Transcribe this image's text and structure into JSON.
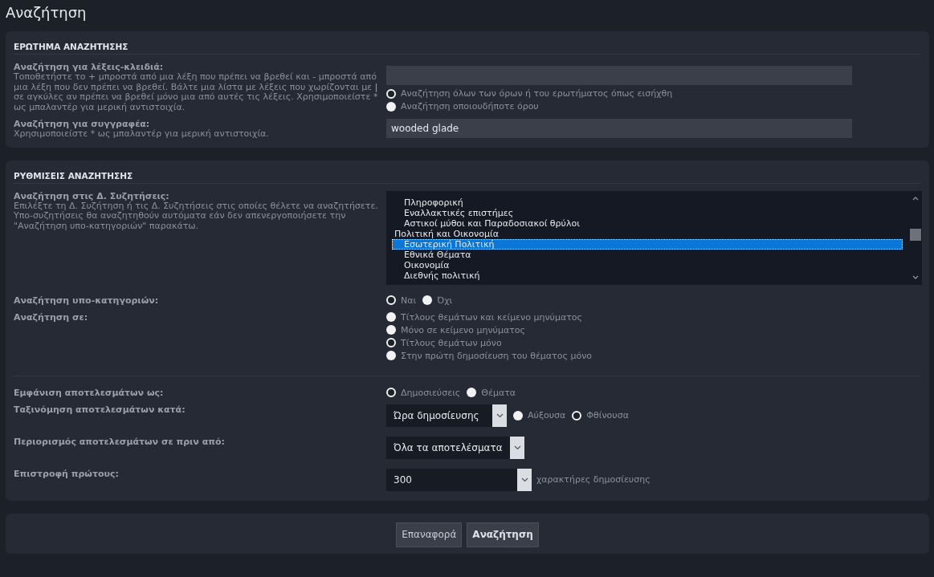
{
  "page_title": "Αναζήτηση",
  "query_panel": {
    "heading": "ΕΡΩΤΗΜΑ ΑΝΑΖΗΤΗΣΗΣ",
    "keywords": {
      "label": "Αναζήτηση για λέξεις-κλειδιά:",
      "description": "Τοποθετήστε το + μπροστά από μια λέξη που πρέπει να βρεθεί και - μπροστά από μια λέξη που δεν πρέπει να βρεθεί. Βάλτε μια λίστα με λέξεις που χωρίζονται με **|** σε αγκύλες αν πρέπει να βρεθεί μόνο μια από αυτές τις λέξεις. Χρησιμοποιείστε * ως μπαλαντέρ για μερική αντιστοιχία.",
      "options": [
        {
          "label": "Αναζήτηση όλων των όρων ή του ερωτήματος όπως εισήχθη",
          "selected": true
        },
        {
          "label": "Αναζήτηση οποιουδήποτε όρου",
          "selected": false
        }
      ]
    },
    "author": {
      "label": "Αναζήτηση για συγγραφέα:",
      "description": "Χρησιμοποιείστε * ως μπαλαντέρ για μερική αντιστοιχία.",
      "value": "wooded glade"
    }
  },
  "settings_panel": {
    "heading": "ΡΥΘΜΙΣΕΙΣ ΑΝΑΖΗΤΗΣΗΣ",
    "forums": {
      "label": "Αναζήτηση στις Δ. Συζητήσεις:",
      "description": "Επιλέξτε τη Δ. Συζήτηση ή τις Δ. Συζητήσεις στις οποίες θέλετε να αναζητήσετε. Υπο-συζητήσεις θα αναζητηθούν αυτόματα εάν δεν απενεργοποιήσετε την \"Αναζήτηση υπο-κατηγοριών\" παρακάτω.",
      "groups": [
        {
          "children": [
            {
              "label": "Πληροφορική",
              "selected": false
            },
            {
              "label": "Εναλλακτικές επιστήμες",
              "selected": false
            },
            {
              "label": "Αστικοί μύθοι και Παραδοσιακοί θρύλοι",
              "selected": false
            }
          ]
        },
        {
          "label": "Πολιτική και Οικονομία",
          "selected": false,
          "children": [
            {
              "label": "Εσωτερική Πολιτική",
              "selected": true
            },
            {
              "label": "Εθνικά Θέματα",
              "selected": false
            },
            {
              "label": "Οικονομία",
              "selected": false
            },
            {
              "label": "Διεθνής πολιτική",
              "selected": false
            }
          ]
        }
      ]
    },
    "rows": [
      {
        "kind": "radio_inline",
        "label": "Αναζήτηση υπο-κατηγοριών:",
        "options": [
          {
            "label": "Ναι",
            "selected": true
          },
          {
            "label": "Όχι",
            "selected": false
          }
        ]
      },
      {
        "kind": "radio_stack",
        "label": "Αναζήτηση σε:",
        "options": [
          {
            "label": "Τίτλους θεμάτων και κείμενο μηνύματος",
            "selected": false
          },
          {
            "label": "Μόνο σε κείμενο μηνύματος",
            "selected": false
          },
          {
            "label": "Τίτλους θεμάτων μόνο",
            "selected": true
          },
          {
            "label": "Στην πρώτη δημοσίευση του θέματος μόνο",
            "selected": false
          }
        ]
      },
      {
        "kind": "divider"
      },
      {
        "kind": "radio_inline",
        "label": "Εμφάνιση αποτελεσμάτων ως:",
        "options": [
          {
            "label": "Δημοσιεύσεις",
            "selected": true
          },
          {
            "label": "Θέματα",
            "selected": false
          }
        ]
      },
      {
        "kind": "select",
        "label": "Ταξινόμηση αποτελεσμάτων κατά:",
        "value": "Ώρα δημοσίευσης",
        "options": [
          {
            "label": "Αύξουσα",
            "selected": false
          },
          {
            "label": "Φθίνουσα",
            "selected": true
          }
        ]
      },
      {
        "kind": "select",
        "label": "Περιορισμός αποτελεσμάτων σε πριν από:",
        "value": "Όλα τα αποτελέσματα"
      },
      {
        "kind": "select",
        "label": "Επιστροφή πρώτους:",
        "value": "300",
        "suffix": "χαρακτήρες δημοσίευσης"
      }
    ]
  },
  "buttons": [
    {
      "label": "Επαναφορά",
      "kind": "reset"
    },
    {
      "label": "Αναζήτηση",
      "kind": "submit"
    }
  ]
}
